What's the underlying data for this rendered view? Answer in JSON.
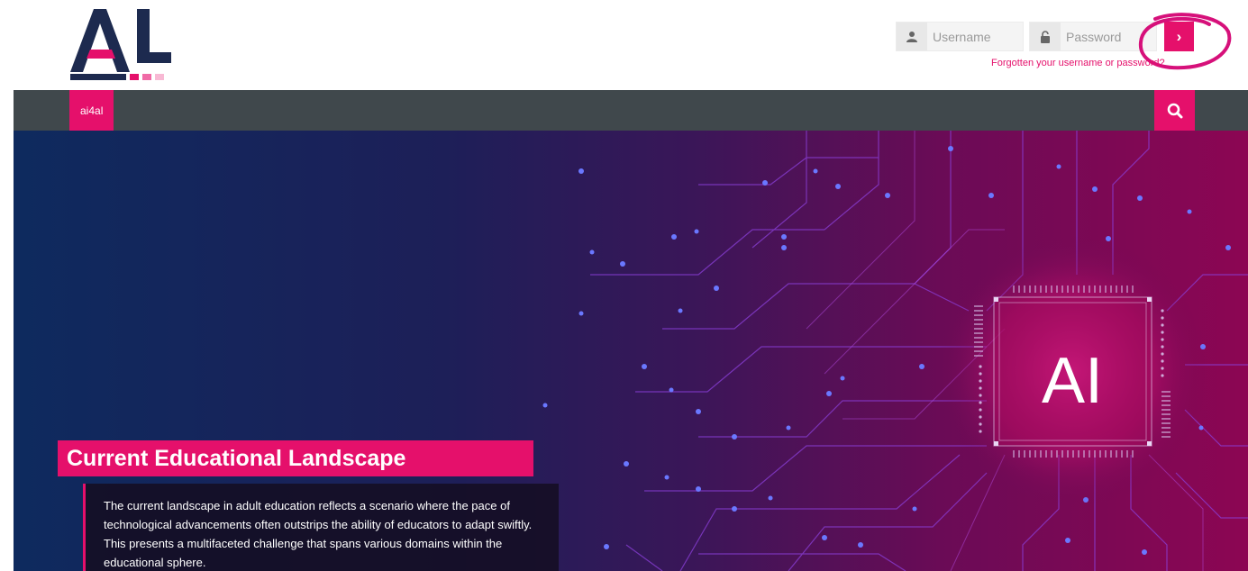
{
  "header": {
    "logo_text": "AL",
    "username_placeholder": "Username",
    "password_placeholder": "Password",
    "login_button_symbol": "›",
    "forgot_link": "Forgotten your username or password?"
  },
  "nav": {
    "items": [
      {
        "label": "ai4al"
      }
    ],
    "search_icon": "search-icon"
  },
  "hero": {
    "chip_label": "AI",
    "title": "Current Educational Landscape",
    "body": "The current landscape in adult education reflects a scenario where the pace of technological advancements often outstrips the ability of educators to adapt swiftly. This presents a multifaceted challenge that spans various domains within the educational sphere."
  },
  "colors": {
    "accent": "#e5106b",
    "navbar": "#40484c",
    "logo_navy": "#1d2a4f",
    "hero_left": "#0e2a5e",
    "hero_right": "#8c0653"
  }
}
